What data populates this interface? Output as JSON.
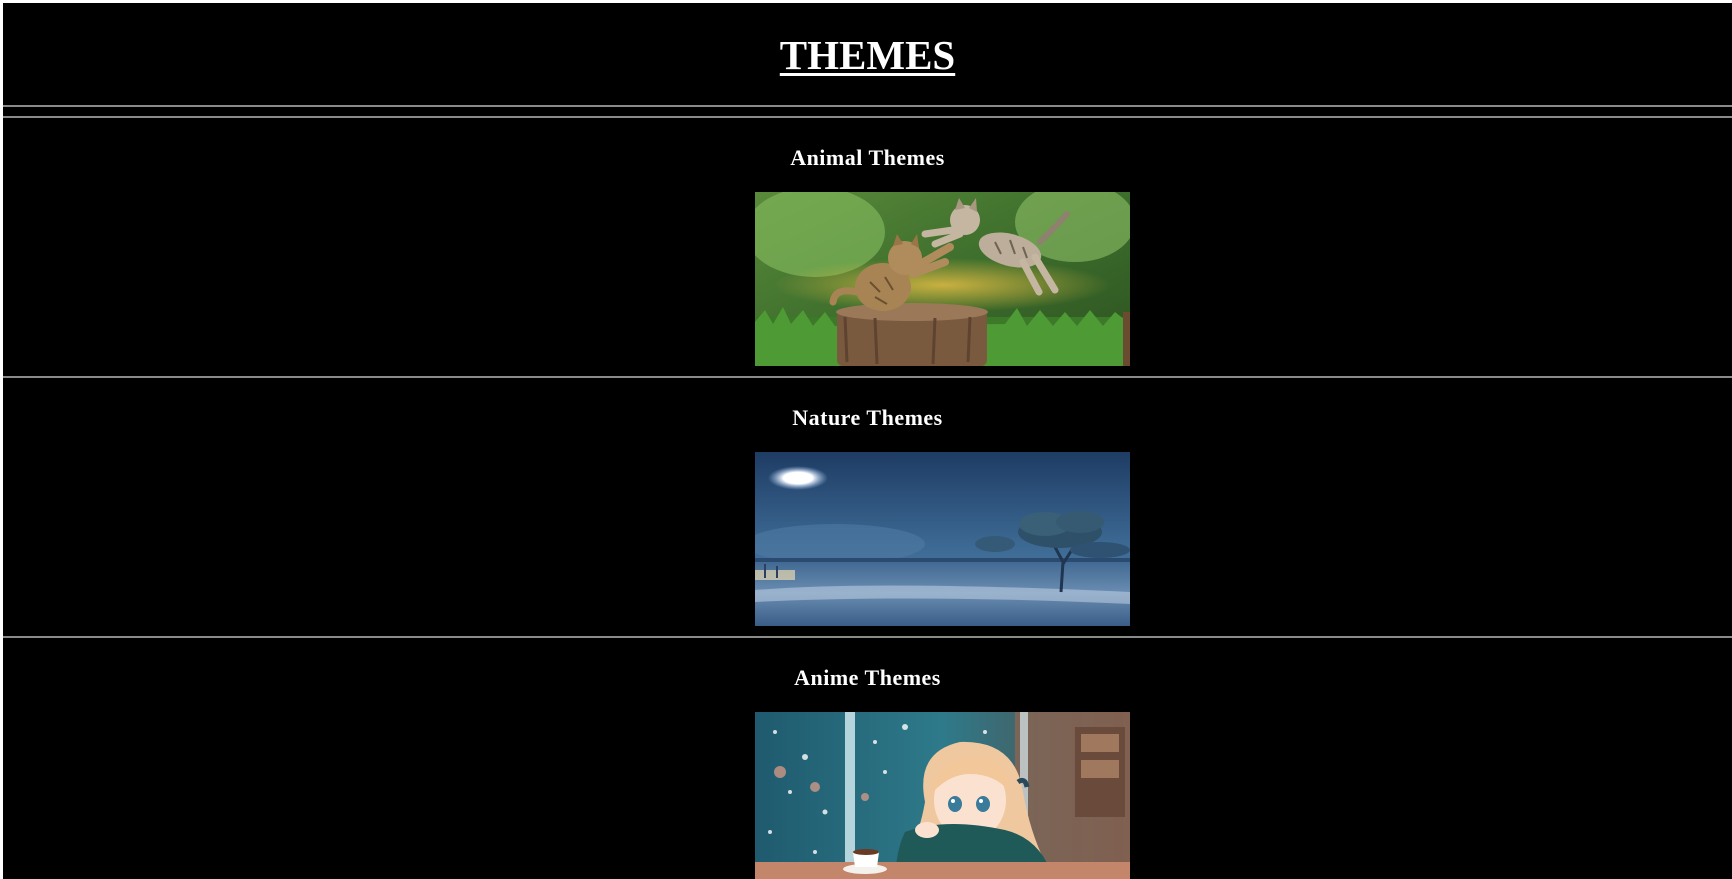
{
  "page": {
    "title": "THEMES",
    "background": "#000000",
    "text_color": "#ffffff",
    "rule_color": "#8a8a8a"
  },
  "sections": [
    {
      "heading": "Animal Themes",
      "image": "two-kittens-playing-on-tree-stump"
    },
    {
      "heading": "Nature Themes",
      "image": "moonlit-blue-landscape-with-tree"
    },
    {
      "heading": "Anime Themes",
      "image": "anime-girl-at-cafe-window"
    }
  ]
}
